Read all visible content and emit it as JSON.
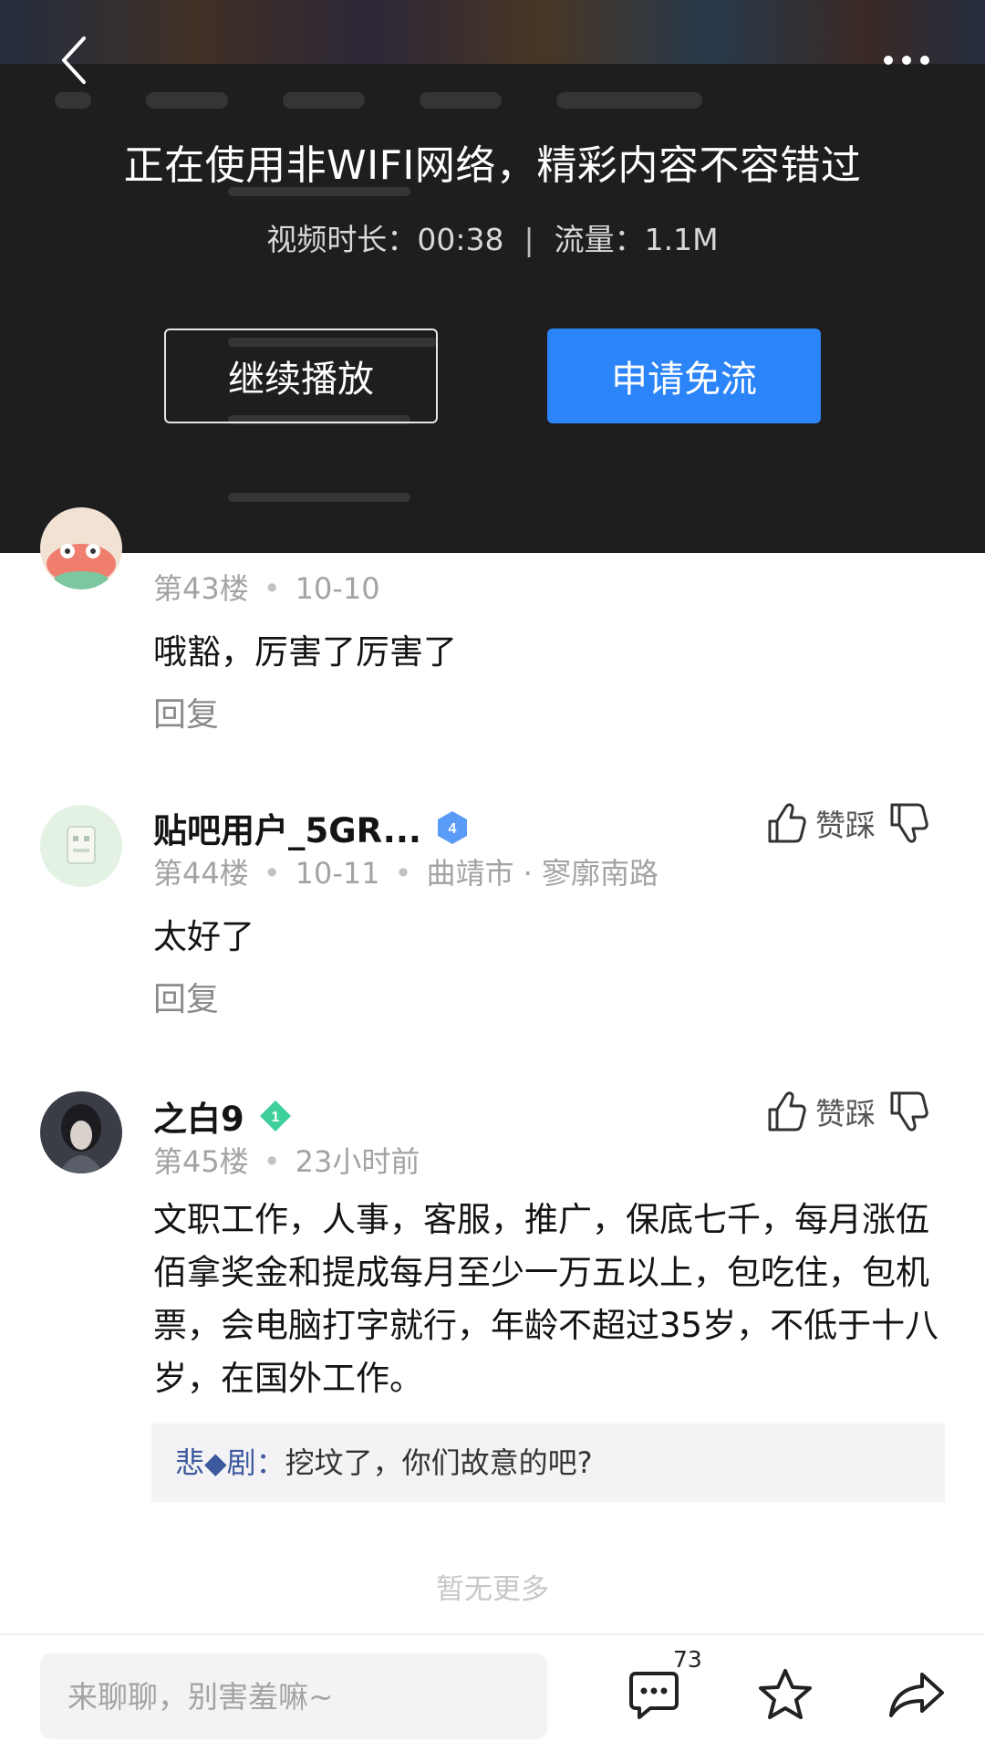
{
  "video_overlay": {
    "notice_title": "正在使用非WIFI网络，精彩内容不容错过",
    "duration_text": "视频时长：00:38",
    "separator": "|",
    "traffic_text": "流量：1.1M",
    "continue_button": "继续播放",
    "free_data_button": "申请免流",
    "back_icon": "chevron-left-icon",
    "more_icon": "more-dots-icon"
  },
  "comments": [
    {
      "floor": "第43楼",
      "date": "10-10",
      "content": "哦豁，厉害了厉害了",
      "reply_label": "回复"
    },
    {
      "author": "贴吧用户_5GR...",
      "level": "4",
      "level_color": "#5b9bf8",
      "floor": "第44楼",
      "date": "10-11",
      "location": "曲靖市 · 寥廓南路",
      "content": "太好了",
      "reply_label": "回复",
      "vote_label": "赞踩"
    },
    {
      "author": "之白9",
      "level": "1",
      "level_color": "#3ecf9a",
      "floor": "第45楼",
      "date": "23小时前",
      "content": "文职工作，人事，客服，推广，保底七千，每月涨伍佰拿奖金和提成每月至少一万五以上，包吃住，包机票，会电脑打字就行，年龄不超过35岁，不低于十八岁，在国外工作。",
      "vote_label": "赞踩",
      "sub_reply": {
        "user": "悲◆剧：",
        "text": "挖坟了，你们故意的吧?"
      }
    }
  ],
  "no_more_text": "暂无更多",
  "bottom_bar": {
    "input_placeholder": "来聊聊，别害羞嘛~",
    "comment_count": "73"
  },
  "colors": {
    "accent_blue": "#2b84f8",
    "overlay_bg": "#1e1e1e"
  }
}
